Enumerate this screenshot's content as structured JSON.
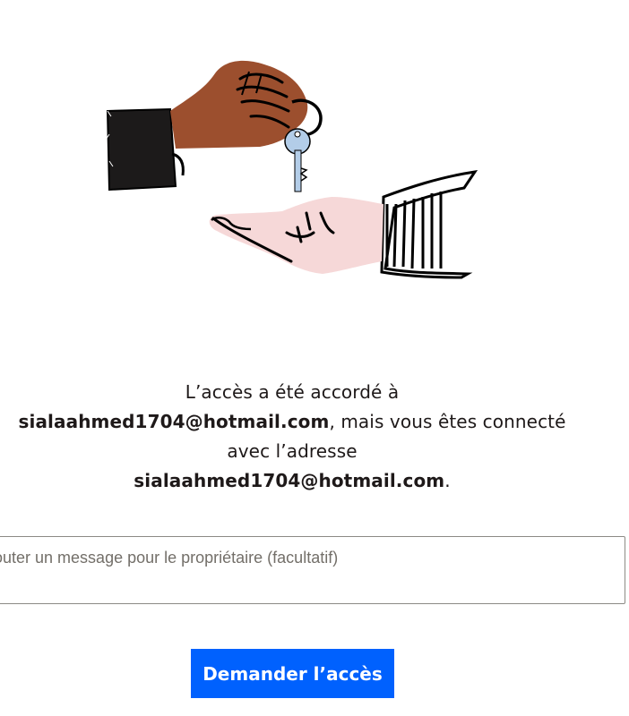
{
  "message": {
    "prefix": "L’accès a été accordé à",
    "granted_email": "sialaahmed1704@hotmail.com",
    "middle": ", mais vous êtes connecté avec l’adresse",
    "signed_in_email": "sialaahmed1704@hotmail.com",
    "suffix": "."
  },
  "request_form": {
    "message_placeholder": "Ajouter un message pour le propriétaire (facultatif)",
    "message_value": "",
    "submit_label": "Demander l’accès"
  },
  "colors": {
    "button": "#0061fe",
    "text": "#1e1919",
    "input_border": "#8c8a85",
    "giving_hand": "#a0522d",
    "receiving_hand": "#f6d8d8",
    "key": "#b3cde8"
  },
  "illustration": "hand-giving-key-illustration"
}
